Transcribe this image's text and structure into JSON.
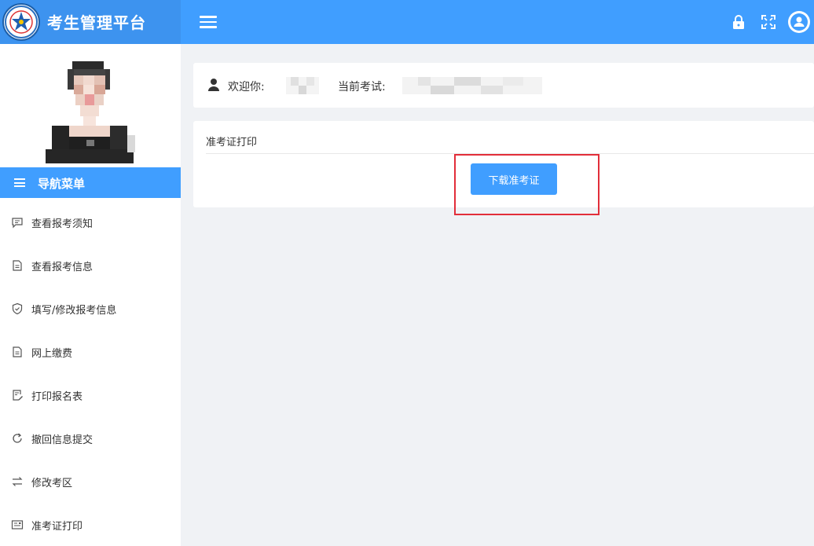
{
  "header": {
    "brand_title": "考生管理平台",
    "icons": [
      "lock-icon",
      "fullscreen-icon",
      "user-avatar-icon"
    ]
  },
  "sidebar": {
    "nav_title": "导航菜单",
    "items": [
      {
        "label": "查看报考须知",
        "icon": "message-icon"
      },
      {
        "label": "查看报考信息",
        "icon": "document-icon"
      },
      {
        "label": "填写/修改报考信息",
        "icon": "shield-check-icon"
      },
      {
        "label": "网上缴费",
        "icon": "document-icon"
      },
      {
        "label": "打印报名表",
        "icon": "edit-document-icon"
      },
      {
        "label": "撤回信息提交",
        "icon": "refresh-icon"
      },
      {
        "label": "修改考区",
        "icon": "switch-icon"
      },
      {
        "label": "准考证打印",
        "icon": "ticket-icon"
      }
    ]
  },
  "welcome": {
    "welcome_label": "欢迎你:",
    "exam_label": "当前考试:"
  },
  "admit": {
    "title": "准考证打印",
    "download_label": "下载准考证"
  },
  "colors": {
    "primary": "#409eff",
    "highlight": "#e22e3a",
    "background": "#f0f2f5"
  }
}
